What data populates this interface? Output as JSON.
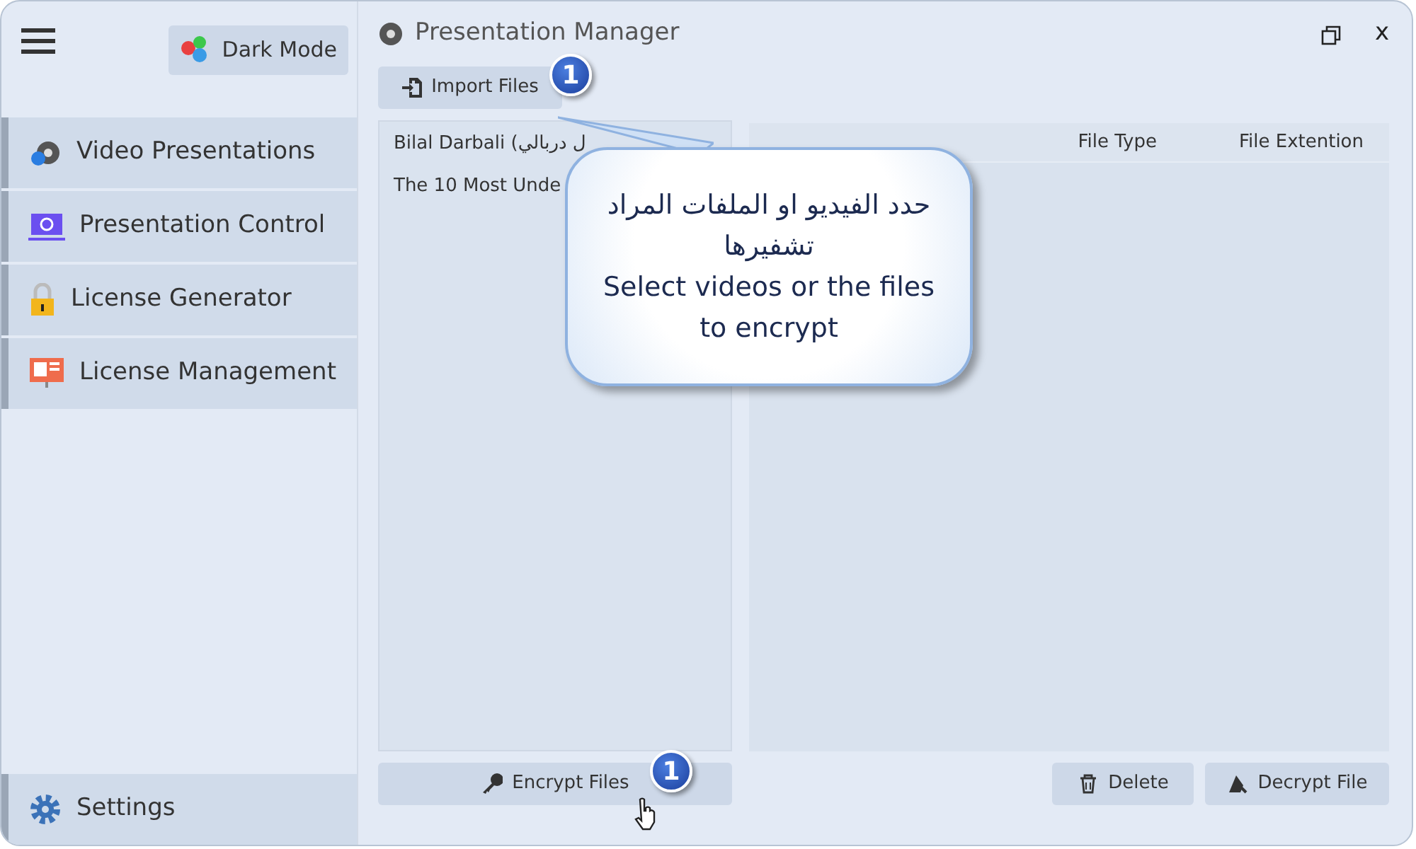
{
  "window": {
    "title": "Presentation Manager",
    "close": "x"
  },
  "sidebar": {
    "dark_mode": "Dark Mode",
    "items": [
      {
        "label": "Video Presentations",
        "kind": "video"
      },
      {
        "label": "Presentation Control",
        "kind": "control"
      },
      {
        "label": "License Generator",
        "kind": "lock"
      },
      {
        "label": "License Management",
        "kind": "board"
      }
    ],
    "settings": "Settings"
  },
  "import_button": "Import Files",
  "files": [
    "Bilal Darbali (ل دربالي",
    "The 10 Most Unde"
  ],
  "table": {
    "columns": [
      "File Type",
      "File Extention"
    ]
  },
  "buttons": [
    {
      "kind": "encrypt",
      "label": "Encrypt Files"
    },
    {
      "kind": "delete",
      "label": "Delete"
    },
    {
      "kind": "decrypt",
      "label": "Decrypt File"
    }
  ],
  "callout": {
    "lines": [
      "حدد الفيديو او الملفات المراد تشفيرها",
      "Select videos or the files to encrypt"
    ]
  },
  "badges": [
    "1",
    "1"
  ]
}
